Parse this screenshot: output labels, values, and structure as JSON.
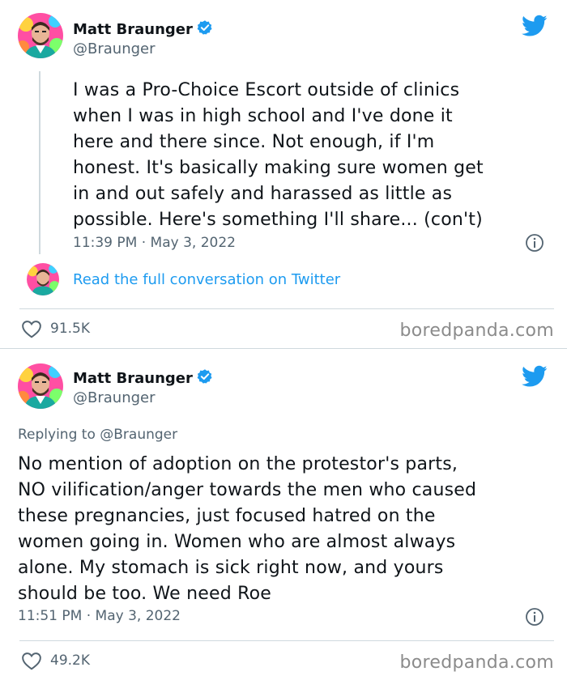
{
  "tweets": [
    {
      "author_name": "Matt Braunger",
      "handle": "@Braunger",
      "replying_to": "",
      "text_lines": [
        "I was a Pro-Choice Escort outside of clinics",
        "when I was in high school and I've done it",
        "here and there since. Not enough, if I'm",
        "honest. It's basically making sure women get",
        "in and out safely and harassed as little as",
        "possible. Here's something I'll share... (con't)"
      ],
      "timestamp": "11:39 PM · May 3, 2022",
      "read_more": "Read the full conversation on Twitter",
      "likes": "91.5K",
      "watermark": "boredpanda.com"
    },
    {
      "author_name": "Matt Braunger",
      "handle": "@Braunger",
      "replying_to": "Replying to @Braunger",
      "text_lines": [
        "No mention of adoption on the protestor's parts,",
        "NO vilification/anger towards the men who caused",
        "these pregnancies, just focused hatred on the",
        "women going in. Women who are almost always",
        "alone. My stomach is sick right now, and yours",
        "should be too. We need Roe"
      ],
      "timestamp": "11:51 PM · May 3, 2022",
      "likes": "49.2K",
      "watermark": "boredpanda.com"
    }
  ],
  "icons": {
    "verified": "verified-badge-icon",
    "bird": "twitter-bird-icon",
    "info": "info-icon",
    "like": "heart-icon"
  },
  "colors": {
    "link": "#1d9bf0",
    "secondary_text": "#536471",
    "primary_text": "#0f1419",
    "avatar_bg": "#ff4fa3"
  }
}
